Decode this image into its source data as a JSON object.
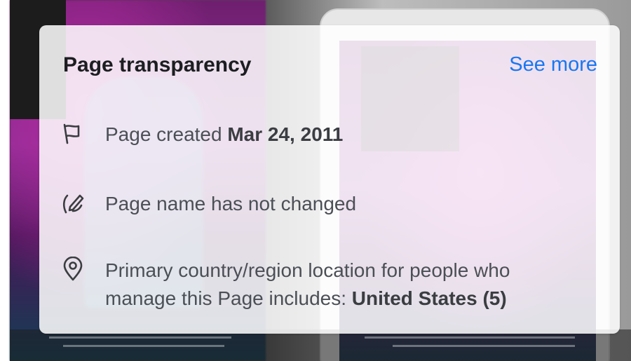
{
  "card": {
    "title": "Page transparency",
    "see_more_label": "See more",
    "rows": [
      {
        "icon": "flag-icon",
        "prefix": "Page created ",
        "value": "Mar 24, 2011"
      },
      {
        "icon": "edit-pencil-icon",
        "text": "Page name has not changed"
      },
      {
        "icon": "location-pin-icon",
        "line1": "Primary country/region location for people who",
        "line2_prefix": "manage this Page includes: ",
        "line2_value": "United States (5)"
      }
    ]
  },
  "colors": {
    "link": "#1877f2",
    "title": "#1c1e21",
    "body_text": "#4b4f56"
  }
}
